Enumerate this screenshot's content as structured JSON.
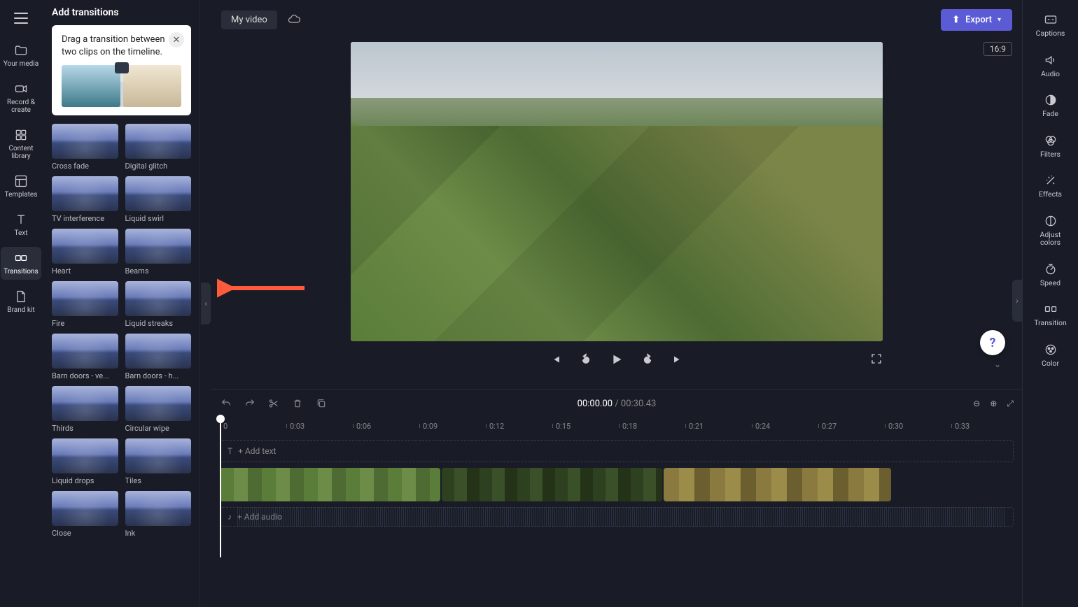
{
  "left_rail": {
    "items": [
      {
        "label": "Your media",
        "icon": "folder"
      },
      {
        "label": "Record & create",
        "icon": "camera"
      },
      {
        "label": "Content library",
        "icon": "library"
      },
      {
        "label": "Templates",
        "icon": "templates"
      },
      {
        "label": "Text",
        "icon": "text"
      },
      {
        "label": "Transitions",
        "icon": "transitions",
        "active": true
      },
      {
        "label": "Brand kit",
        "icon": "brand"
      }
    ]
  },
  "panel": {
    "title": "Add transitions",
    "tip": "Drag a transition between two clips on the timeline.",
    "transitions": [
      "Cross fade",
      "Digital glitch",
      "TV interference",
      "Liquid swirl",
      "Heart",
      "Beams",
      "Fire",
      "Liquid streaks",
      "Barn doors - ve...",
      "Barn doors - h...",
      "Thirds",
      "Circular wipe",
      "Liquid drops",
      "Tiles",
      "Close",
      "Ink"
    ]
  },
  "topbar": {
    "title": "My video",
    "export": "Export"
  },
  "preview": {
    "aspect": "16:9"
  },
  "timeline": {
    "current": "00:00.00",
    "total": "00:30.43",
    "ticks": [
      "0",
      "0:03",
      "0:06",
      "0:09",
      "0:12",
      "0:15",
      "0:18",
      "0:21",
      "0:24",
      "0:27",
      "0:30",
      "0:33"
    ],
    "add_text": "+ Add text",
    "add_audio": "+ Add audio"
  },
  "right_rail": {
    "items": [
      {
        "label": "Captions"
      },
      {
        "label": "Audio"
      },
      {
        "label": "Fade"
      },
      {
        "label": "Filters"
      },
      {
        "label": "Effects"
      },
      {
        "label": "Adjust colors"
      },
      {
        "label": "Speed"
      },
      {
        "label": "Transition"
      },
      {
        "label": "Color"
      }
    ]
  }
}
